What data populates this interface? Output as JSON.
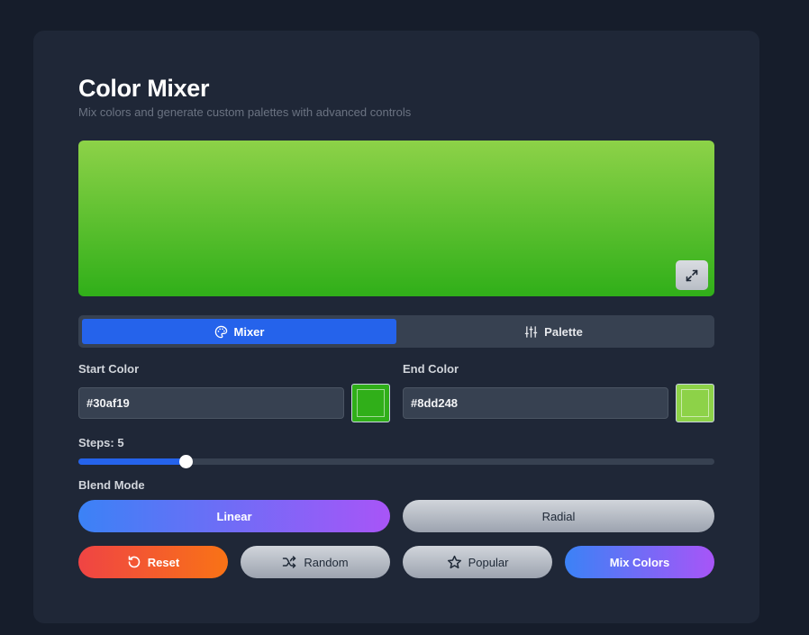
{
  "header": {
    "title": "Color Mixer",
    "subtitle": "Mix colors and generate custom palettes with advanced controls"
  },
  "preview": {
    "start_color": "#8dd248",
    "end_color": "#30af19",
    "expand_icon": "expand-icon"
  },
  "tabs": [
    {
      "label": "Mixer",
      "icon": "palette-icon",
      "active": true
    },
    {
      "label": "Palette",
      "icon": "sliders-icon",
      "active": false
    }
  ],
  "start_color": {
    "label": "Start Color",
    "value": "#30af19",
    "swatch": "#30af19"
  },
  "end_color": {
    "label": "End Color",
    "value": "#8dd248",
    "swatch": "#8dd248"
  },
  "steps": {
    "label": "Steps: 5",
    "value": 5,
    "fill_fraction": 0.168
  },
  "blend_mode": {
    "label": "Blend Mode",
    "options": [
      {
        "label": "Linear",
        "selected": true
      },
      {
        "label": "Radial",
        "selected": false
      }
    ]
  },
  "actions": {
    "reset": "Reset",
    "random": "Random",
    "popular": "Popular",
    "mix": "Mix Colors"
  },
  "colors": {
    "accent": "#2563eb",
    "background": "#161d2b",
    "card": "#1f2737"
  }
}
